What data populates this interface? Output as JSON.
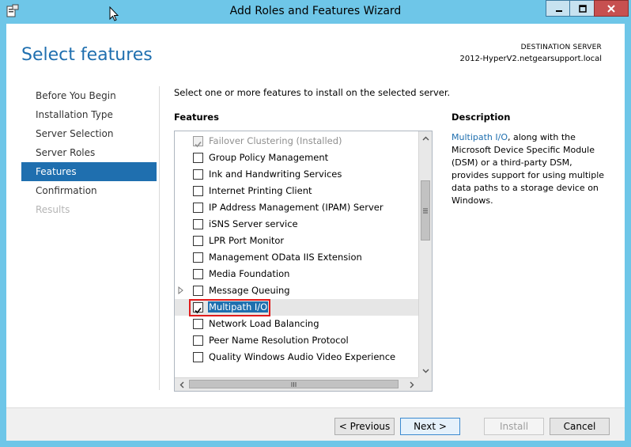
{
  "window": {
    "title": "Add Roles and Features Wizard"
  },
  "header": {
    "page_title": "Select features",
    "destination_label": "DESTINATION SERVER",
    "destination_value": "2012-HyperV2.netgearsupport.local"
  },
  "nav": {
    "items": [
      {
        "label": "Before You Begin",
        "state": "normal"
      },
      {
        "label": "Installation Type",
        "state": "normal"
      },
      {
        "label": "Server Selection",
        "state": "normal"
      },
      {
        "label": "Server Roles",
        "state": "normal"
      },
      {
        "label": "Features",
        "state": "active"
      },
      {
        "label": "Confirmation",
        "state": "normal"
      },
      {
        "label": "Results",
        "state": "disabled"
      }
    ]
  },
  "main": {
    "intro": "Select one or more features to install on the selected server.",
    "features_heading": "Features",
    "features": [
      {
        "label": "Failover Clustering (Installed)",
        "checked": true,
        "disabled": true
      },
      {
        "label": "Group Policy Management",
        "checked": false
      },
      {
        "label": "Ink and Handwriting Services",
        "checked": false
      },
      {
        "label": "Internet Printing Client",
        "checked": false
      },
      {
        "label": "IP Address Management (IPAM) Server",
        "checked": false
      },
      {
        "label": "iSNS Server service",
        "checked": false
      },
      {
        "label": "LPR Port Monitor",
        "checked": false
      },
      {
        "label": "Management OData IIS Extension",
        "checked": false
      },
      {
        "label": "Media Foundation",
        "checked": false
      },
      {
        "label": "Message Queuing",
        "checked": false,
        "expandable": true
      },
      {
        "label": "Multipath I/O",
        "checked": true,
        "selected": true
      },
      {
        "label": "Network Load Balancing",
        "checked": false
      },
      {
        "label": "Peer Name Resolution Protocol",
        "checked": false
      },
      {
        "label": "Quality Windows Audio Video Experience",
        "checked": false
      }
    ]
  },
  "description": {
    "heading": "Description",
    "link": "Multipath I/O",
    "text": ", along with the Microsoft Device Specific Module (DSM) or a third-party DSM, provides support for using multiple data paths to a storage device on Windows."
  },
  "footer": {
    "previous": "< Previous",
    "next": "Next >",
    "install": "Install",
    "cancel": "Cancel"
  },
  "colors": {
    "accent": "#1f6faf",
    "window_frame": "#6ec6e8",
    "highlight": "#e21b1b",
    "close_button": "#c75050"
  }
}
